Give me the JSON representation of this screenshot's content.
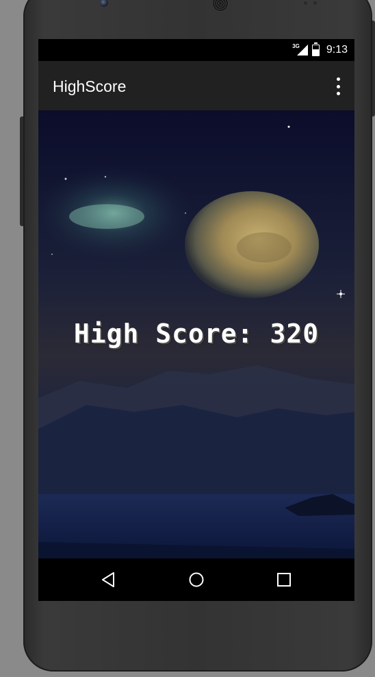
{
  "status_bar": {
    "network_type": "3G",
    "time": "9:13",
    "signal_icon": "signal-icon",
    "battery_icon": "battery-charging-icon"
  },
  "app_bar": {
    "title": "HighScore",
    "overflow_icon": "more-vert-icon"
  },
  "main": {
    "score_text": "High Score: 320"
  },
  "nav_bar": {
    "back_icon": "back-triangle-icon",
    "home_icon": "home-circle-icon",
    "recents_icon": "recents-square-icon"
  },
  "colors": {
    "app_bar": "#212121",
    "status_bar": "#000000",
    "text": "#ffffff"
  }
}
